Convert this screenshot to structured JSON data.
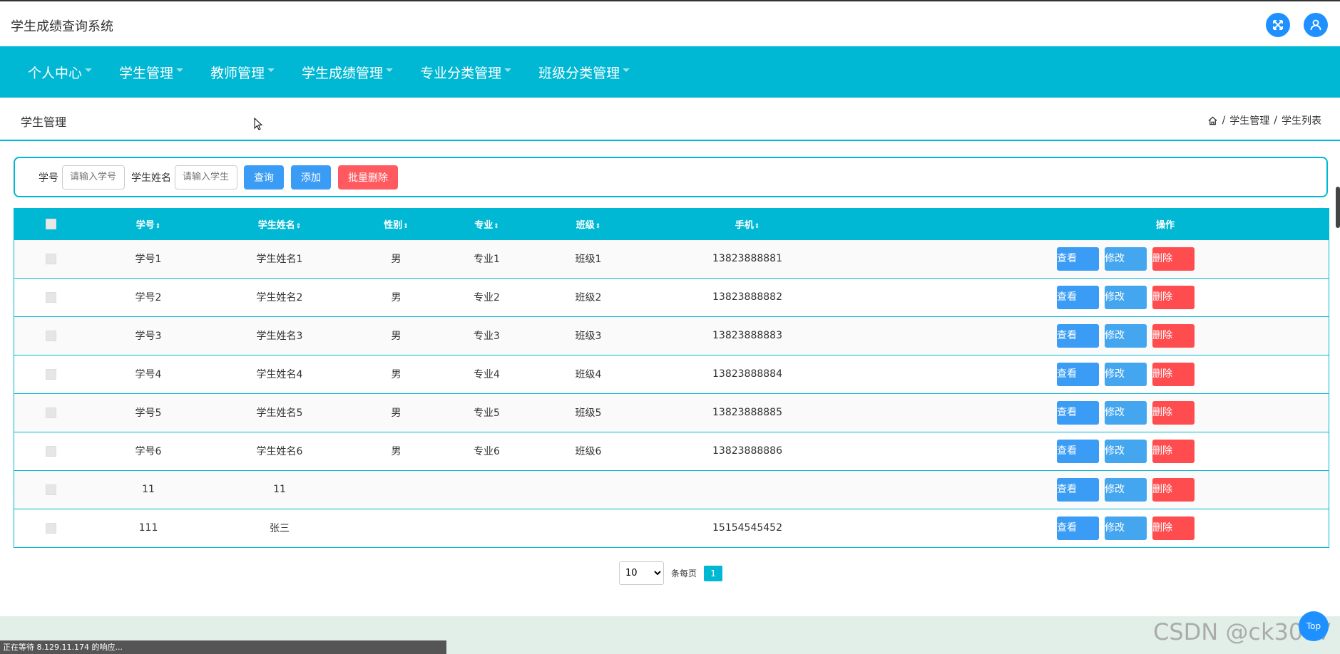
{
  "app": {
    "title": "学生成绩查询系统"
  },
  "header": {
    "fullscreen_icon": "fullscreen-icon",
    "user_icon": "user-icon",
    "accent": "#1e90ff"
  },
  "nav": {
    "color": "#00b8d4",
    "items": [
      {
        "label": "个人中心"
      },
      {
        "label": "学生管理"
      },
      {
        "label": "教师管理"
      },
      {
        "label": "学生成绩管理"
      },
      {
        "label": "专业分类管理"
      },
      {
        "label": "班级分类管理"
      }
    ]
  },
  "page": {
    "title": "学生管理",
    "breadcrumb": {
      "home_icon": "home-icon",
      "section": "学生管理",
      "current": "学生列表"
    }
  },
  "search": {
    "id_label": "学号",
    "id_placeholder": "请输入学号",
    "name_label": "学生姓名",
    "name_placeholder": "请输入学生",
    "query_button": "查询",
    "add_button": "添加",
    "batch_delete_button": "批量删除"
  },
  "table": {
    "columns": [
      "学号",
      "学生姓名",
      "性别",
      "专业",
      "班级",
      "手机",
      "操作"
    ],
    "rows": [
      {
        "id": "学号1",
        "name": "学生姓名1",
        "gender": "男",
        "major": "专业1",
        "class": "班级1",
        "phone": "13823888881"
      },
      {
        "id": "学号2",
        "name": "学生姓名2",
        "gender": "男",
        "major": "专业2",
        "class": "班级2",
        "phone": "13823888882"
      },
      {
        "id": "学号3",
        "name": "学生姓名3",
        "gender": "男",
        "major": "专业3",
        "class": "班级3",
        "phone": "13823888883"
      },
      {
        "id": "学号4",
        "name": "学生姓名4",
        "gender": "男",
        "major": "专业4",
        "class": "班级4",
        "phone": "13823888884"
      },
      {
        "id": "学号5",
        "name": "学生姓名5",
        "gender": "男",
        "major": "专业5",
        "class": "班级5",
        "phone": "13823888885"
      },
      {
        "id": "学号6",
        "name": "学生姓名6",
        "gender": "男",
        "major": "专业6",
        "class": "班级6",
        "phone": "13823888886"
      },
      {
        "id": "11",
        "name": "11",
        "gender": "",
        "major": "",
        "class": "",
        "phone": ""
      },
      {
        "id": "111",
        "name": "张三",
        "gender": "",
        "major": "",
        "class": "",
        "phone": "15154545452"
      }
    ],
    "actions": {
      "view": "查看",
      "edit": "修改",
      "delete": "删除"
    }
  },
  "pagination": {
    "page_size": "10",
    "per_page_label": "条每页",
    "current_page": "1"
  },
  "status_bar": {
    "text": "正在等待 8.129.11.174 的响应..."
  },
  "back_to_top": {
    "label": "Top"
  },
  "watermark": {
    "text": "CSDN @ck3017"
  }
}
